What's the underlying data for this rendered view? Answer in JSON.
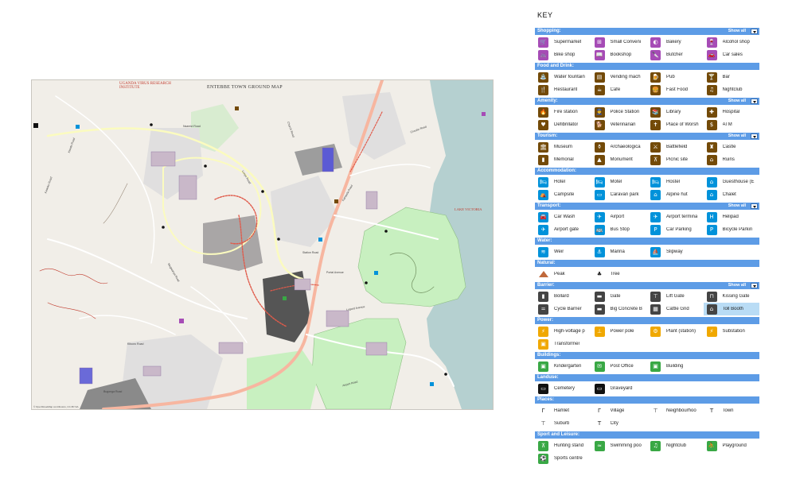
{
  "map": {
    "title": "ENTEBBE TOWN GROUND MAP",
    "lake_label": "LAKE VICTORIA",
    "institute_label": "UGANDA VIRUS RESEARCH INSTITUTE",
    "attribution": "© OpenStreetMap contributors, CC-BY-SA",
    "road_labels": [
      "Nsamizi Road",
      "Kiwafu Road",
      "Kampala Road",
      "Lugard Avenue",
      "Circular Road",
      "Church Road",
      "Mugwanya Road",
      "Station Road",
      "Portal Avenue",
      "Airport Road",
      "Kitooro Road",
      "Bugonga Road",
      "Kawuku Road",
      "Lunyo Road"
    ],
    "colors": {
      "land": "#f1eee8",
      "water": "#b5d0d0",
      "park": "#c8f0c0",
      "forest": "#add19e",
      "residential": "#e0dfdf",
      "primary_road": "#f6d79e",
      "trunk_road": "#f7b6a0",
      "secondary": "#fbfbbf",
      "path_red": "#e05a4a",
      "building": "#c9b8c9",
      "dark_area": "#555555"
    }
  },
  "key": {
    "title": "KEY",
    "sections": [
      {
        "name": "Shopping:",
        "show_all": "Show all",
        "color": "#a64cb6",
        "items": [
          {
            "label": "Supermarket",
            "icon": "basket-icon",
            "glyph": "🛒"
          },
          {
            "label": "Small Conveni",
            "icon": "convenience-icon",
            "glyph": "⊞"
          },
          {
            "label": "Bakery",
            "icon": "bakery-icon",
            "glyph": "◐"
          },
          {
            "label": "Alcohol shop",
            "icon": "bottle-icon",
            "glyph": "🍷"
          },
          {
            "label": "Bike shop",
            "icon": "bike-icon",
            "glyph": "🚲"
          },
          {
            "label": "Bookshop",
            "icon": "book-icon",
            "glyph": "📖"
          },
          {
            "label": "Butcher",
            "icon": "knife-icon",
            "glyph": "🔪"
          },
          {
            "label": "Car sales",
            "icon": "car-icon",
            "glyph": "🚗"
          }
        ]
      },
      {
        "name": "Food and Drink:",
        "show_all": "",
        "color": "#734a08",
        "items": [
          {
            "label": "Water fountain",
            "icon": "fountain-icon",
            "glyph": "⛲"
          },
          {
            "label": "Vending mach",
            "icon": "vending-icon",
            "glyph": "▤"
          },
          {
            "label": "Pub",
            "icon": "beer-icon",
            "glyph": "🍺"
          },
          {
            "label": "Bar",
            "icon": "cocktail-icon",
            "glyph": "🍸"
          },
          {
            "label": "Restaurant",
            "icon": "cutlery-icon",
            "glyph": "🍴"
          },
          {
            "label": "Cafe",
            "icon": "cup-icon",
            "glyph": "☕"
          },
          {
            "label": "Fast Food",
            "icon": "burger-icon",
            "glyph": "🍔"
          },
          {
            "label": "Nightclub",
            "icon": "music-icon",
            "glyph": "♫"
          }
        ]
      },
      {
        "name": "Amenity:",
        "show_all": "Show all",
        "color": "#734a08",
        "items": [
          {
            "label": "Fire station",
            "icon": "fire-icon",
            "glyph": "🔥"
          },
          {
            "label": "Police Station",
            "icon": "police-icon",
            "glyph": "👮"
          },
          {
            "label": "Library",
            "icon": "library-icon",
            "glyph": "📚"
          },
          {
            "label": "Hospital",
            "icon": "hospital-icon",
            "glyph": "✚"
          },
          {
            "label": "Defibrillator",
            "icon": "heart-icon",
            "glyph": "♥"
          },
          {
            "label": "Veterinarian",
            "icon": "vet-icon",
            "glyph": "🐕"
          },
          {
            "label": "Place of Worsh",
            "icon": "worship-icon",
            "glyph": "✝"
          },
          {
            "label": "ATM",
            "icon": "atm-icon",
            "glyph": "$"
          }
        ]
      },
      {
        "name": "Tourism:",
        "show_all": "Show all",
        "color": "#734a08",
        "items": [
          {
            "label": "Museum",
            "icon": "museum-icon",
            "glyph": "🏛"
          },
          {
            "label": "Archaeologica",
            "icon": "urn-icon",
            "glyph": "⚱"
          },
          {
            "label": "Battlefield",
            "icon": "swords-icon",
            "glyph": "⚔"
          },
          {
            "label": "Castle",
            "icon": "castle-icon",
            "glyph": "♜"
          },
          {
            "label": "Memorial",
            "icon": "memorial-icon",
            "glyph": "▮"
          },
          {
            "label": "Monument",
            "icon": "monument-icon",
            "glyph": "▲"
          },
          {
            "label": "Picnic site",
            "icon": "picnic-icon",
            "glyph": "⊼"
          },
          {
            "label": "Ruins",
            "icon": "ruins-icon",
            "glyph": "⌂"
          }
        ]
      },
      {
        "name": "Accommodation:",
        "show_all": "",
        "color": "#0092da",
        "items": [
          {
            "label": "Hotel",
            "icon": "bed-icon",
            "glyph": "🛏"
          },
          {
            "label": "Motel",
            "icon": "motel-icon",
            "glyph": "🛏"
          },
          {
            "label": "Hostel",
            "icon": "hostel-icon",
            "glyph": "🛏"
          },
          {
            "label": "Guesthouse (E",
            "icon": "guesthouse-icon",
            "glyph": "⌂"
          },
          {
            "label": "Campsite",
            "icon": "tent-icon",
            "glyph": "⛺"
          },
          {
            "label": "Caravan park",
            "icon": "caravan-icon",
            "glyph": "▭"
          },
          {
            "label": "Alpine hut",
            "icon": "hut-icon",
            "glyph": "⌂"
          },
          {
            "label": "Chalet",
            "icon": "chalet-icon",
            "glyph": "⌂"
          }
        ]
      },
      {
        "name": "Transport:",
        "show_all": "Show all",
        "color": "#0092da",
        "items": [
          {
            "label": "Car Wash",
            "icon": "carwash-icon",
            "glyph": "🚘"
          },
          {
            "label": "Airport",
            "icon": "plane-icon",
            "glyph": "✈"
          },
          {
            "label": "Airport termina",
            "icon": "terminal-icon",
            "glyph": "✈"
          },
          {
            "label": "Helipad",
            "icon": "helipad-icon",
            "glyph": "H"
          },
          {
            "label": "Airport gate",
            "icon": "gate-icon",
            "glyph": "✈"
          },
          {
            "label": "Bus Stop",
            "icon": "bus-icon",
            "glyph": "🚌"
          },
          {
            "label": "Car Parking",
            "icon": "parking-icon",
            "glyph": "P"
          },
          {
            "label": "Bicycle Parkin",
            "icon": "bike-parking-icon",
            "glyph": "P"
          }
        ]
      },
      {
        "name": "Water:",
        "show_all": "",
        "color": "#0092da",
        "items": [
          {
            "label": "Weir",
            "icon": "weir-icon",
            "glyph": "≋"
          },
          {
            "label": "Marina",
            "icon": "anchor-icon",
            "glyph": "⚓"
          },
          {
            "label": "Slipway",
            "icon": "slipway-icon",
            "glyph": "⛵"
          }
        ]
      },
      {
        "name": "Natural:",
        "show_all": "",
        "color": "transparent",
        "items": [
          {
            "label": "Peak",
            "icon": "peak-icon",
            "glyph": ""
          },
          {
            "label": "Tree",
            "icon": "tree-icon",
            "glyph": "♣"
          }
        ]
      },
      {
        "name": "Barrier:",
        "show_all": "Show all",
        "color": "#444444",
        "items": [
          {
            "label": "Bollard",
            "icon": "bollard-icon",
            "glyph": "▮"
          },
          {
            "label": "Gate",
            "icon": "barrier-gate-icon",
            "glyph": "▬"
          },
          {
            "label": "Lift Gate",
            "icon": "lift-gate-icon",
            "glyph": "⊤"
          },
          {
            "label": "Kissing Gate",
            "icon": "kissing-gate-icon",
            "glyph": "⊓"
          },
          {
            "label": "Cycle Barrier",
            "icon": "cycle-barrier-icon",
            "glyph": "="
          },
          {
            "label": "Big Concrete B",
            "icon": "concrete-icon",
            "glyph": "▬"
          },
          {
            "label": "Cattle Grid",
            "icon": "cattle-grid-icon",
            "glyph": "▦"
          },
          {
            "label": "Toll Booth",
            "icon": "toll-icon",
            "glyph": "⌂",
            "highlight": true
          }
        ]
      },
      {
        "name": "Power:",
        "show_all": "",
        "color": "#f0a800",
        "items": [
          {
            "label": "High-voltage p",
            "icon": "pylon-icon",
            "glyph": "⚡"
          },
          {
            "label": "Power pole",
            "icon": "pole-icon",
            "glyph": "⊥"
          },
          {
            "label": "Plant (station)",
            "icon": "plant-icon",
            "glyph": "⚙"
          },
          {
            "label": "Substation",
            "icon": "substation-icon",
            "glyph": "⚡"
          },
          {
            "label": "Transformer",
            "icon": "transformer-icon",
            "glyph": "▣"
          }
        ]
      },
      {
        "name": "Buildings:",
        "show_all": "",
        "color": "#39a845",
        "items": [
          {
            "label": "Kindergarten",
            "icon": "kindergarten-icon",
            "glyph": "▣"
          },
          {
            "label": "Post Office",
            "icon": "mail-icon",
            "glyph": "✉"
          },
          {
            "label": "Building",
            "icon": "building-icon",
            "glyph": "▣"
          }
        ]
      },
      {
        "name": "Landuse:",
        "show_all": "",
        "color": "#111111",
        "items": [
          {
            "label": "Cemetery",
            "icon": "cemetery-icon",
            "glyph": "▭"
          },
          {
            "label": "Graveyard",
            "icon": "graveyard-icon",
            "glyph": "▭"
          }
        ]
      },
      {
        "name": "Places:",
        "show_all": "",
        "color": "transparent",
        "items": [
          {
            "label": "Hamlet",
            "icon": "hamlet-icon",
            "glyph": "Γ"
          },
          {
            "label": "Village",
            "icon": "village-icon",
            "glyph": "Γ"
          },
          {
            "label": "Neighbourhoo",
            "icon": "neighbourhood-icon",
            "glyph": "⊤"
          },
          {
            "label": "Town",
            "icon": "town-icon",
            "glyph": "T"
          },
          {
            "label": "Suburb",
            "icon": "suburb-icon",
            "glyph": "⊤"
          },
          {
            "label": "City",
            "icon": "city-icon",
            "glyph": "T"
          }
        ]
      },
      {
        "name": "Sport and Leisure:",
        "show_all": "",
        "color": "#39a845",
        "items": [
          {
            "label": "Hunting stand",
            "icon": "hunting-icon",
            "glyph": "⊼"
          },
          {
            "label": "Swimming poo",
            "icon": "swim-icon",
            "glyph": "≈"
          },
          {
            "label": "Nightclub",
            "icon": "nightclub-icon",
            "glyph": "♫"
          },
          {
            "label": "Playground",
            "icon": "playground-icon",
            "glyph": "⛹"
          },
          {
            "label": "Sports centre",
            "icon": "sports-icon",
            "glyph": "⚽"
          }
        ]
      }
    ]
  }
}
